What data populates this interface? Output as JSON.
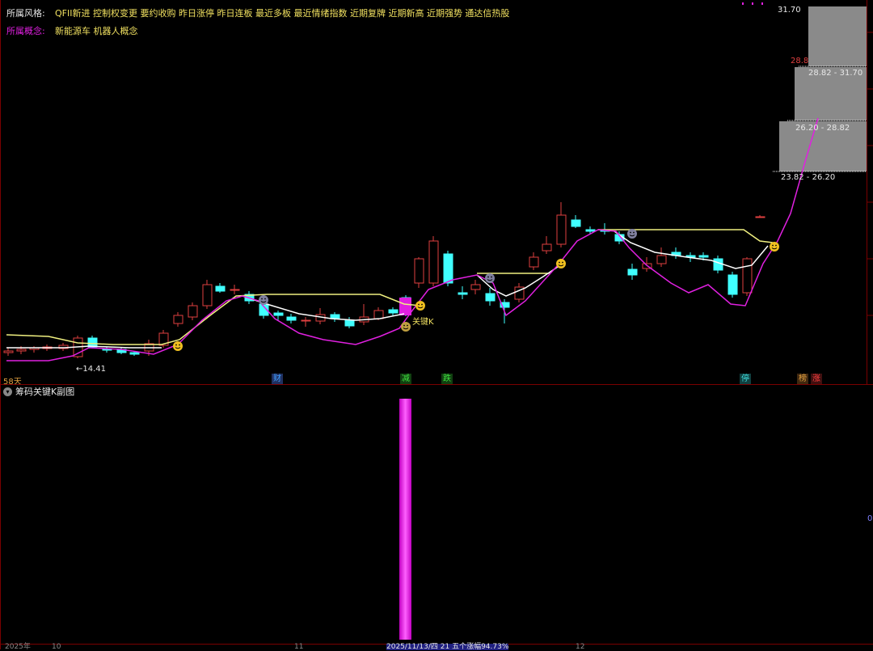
{
  "header": {
    "style_label": "所属风格:",
    "style_value": "QFII新进 控制权变更 要约收购 昨日涨停 昨日连板 最近多板 最近情绪指数 近期复牌 近期新高 近期强势 通达信热股",
    "concept_label": "所属概念:",
    "concept_value": "新能源车 机器人概念"
  },
  "price_panel": {
    "top_price": "31.70",
    "mid_price": "28.8",
    "boxes": [
      {
        "label": "28.82 - 31.70"
      },
      {
        "label": "26.20 - 28.82"
      },
      {
        "label": "23.82 - 26.20"
      }
    ],
    "low_label": "←14.41",
    "key_k_label": "关键K",
    "days_label": "58天"
  },
  "event_markers": [
    {
      "text": "财",
      "color": "#40a0ff"
    },
    {
      "text": "减",
      "color": "#40e040"
    },
    {
      "text": "跌",
      "color": "#40e040"
    },
    {
      "text": "停",
      "color": "#40e0e0"
    },
    {
      "text": "榜",
      "color": "#e0a040"
    },
    {
      "text": "涨",
      "color": "#ff4040"
    }
  ],
  "sub_panel": {
    "title": "筹码关键K副图",
    "right_value": "0"
  },
  "bottom_bar": {
    "left": "2025年",
    "tick1": "10",
    "tick2": "11",
    "center": "2025/11/13/四 21 五个涨幅94.73%",
    "tick3": "12"
  },
  "colors": {
    "up": "#e04040",
    "down": "#40ffff",
    "ma_magenta": "#e020e0",
    "ma_yellow": "#f0f080",
    "ma_white": "#ffffff",
    "bar": "#e020e0"
  }
}
